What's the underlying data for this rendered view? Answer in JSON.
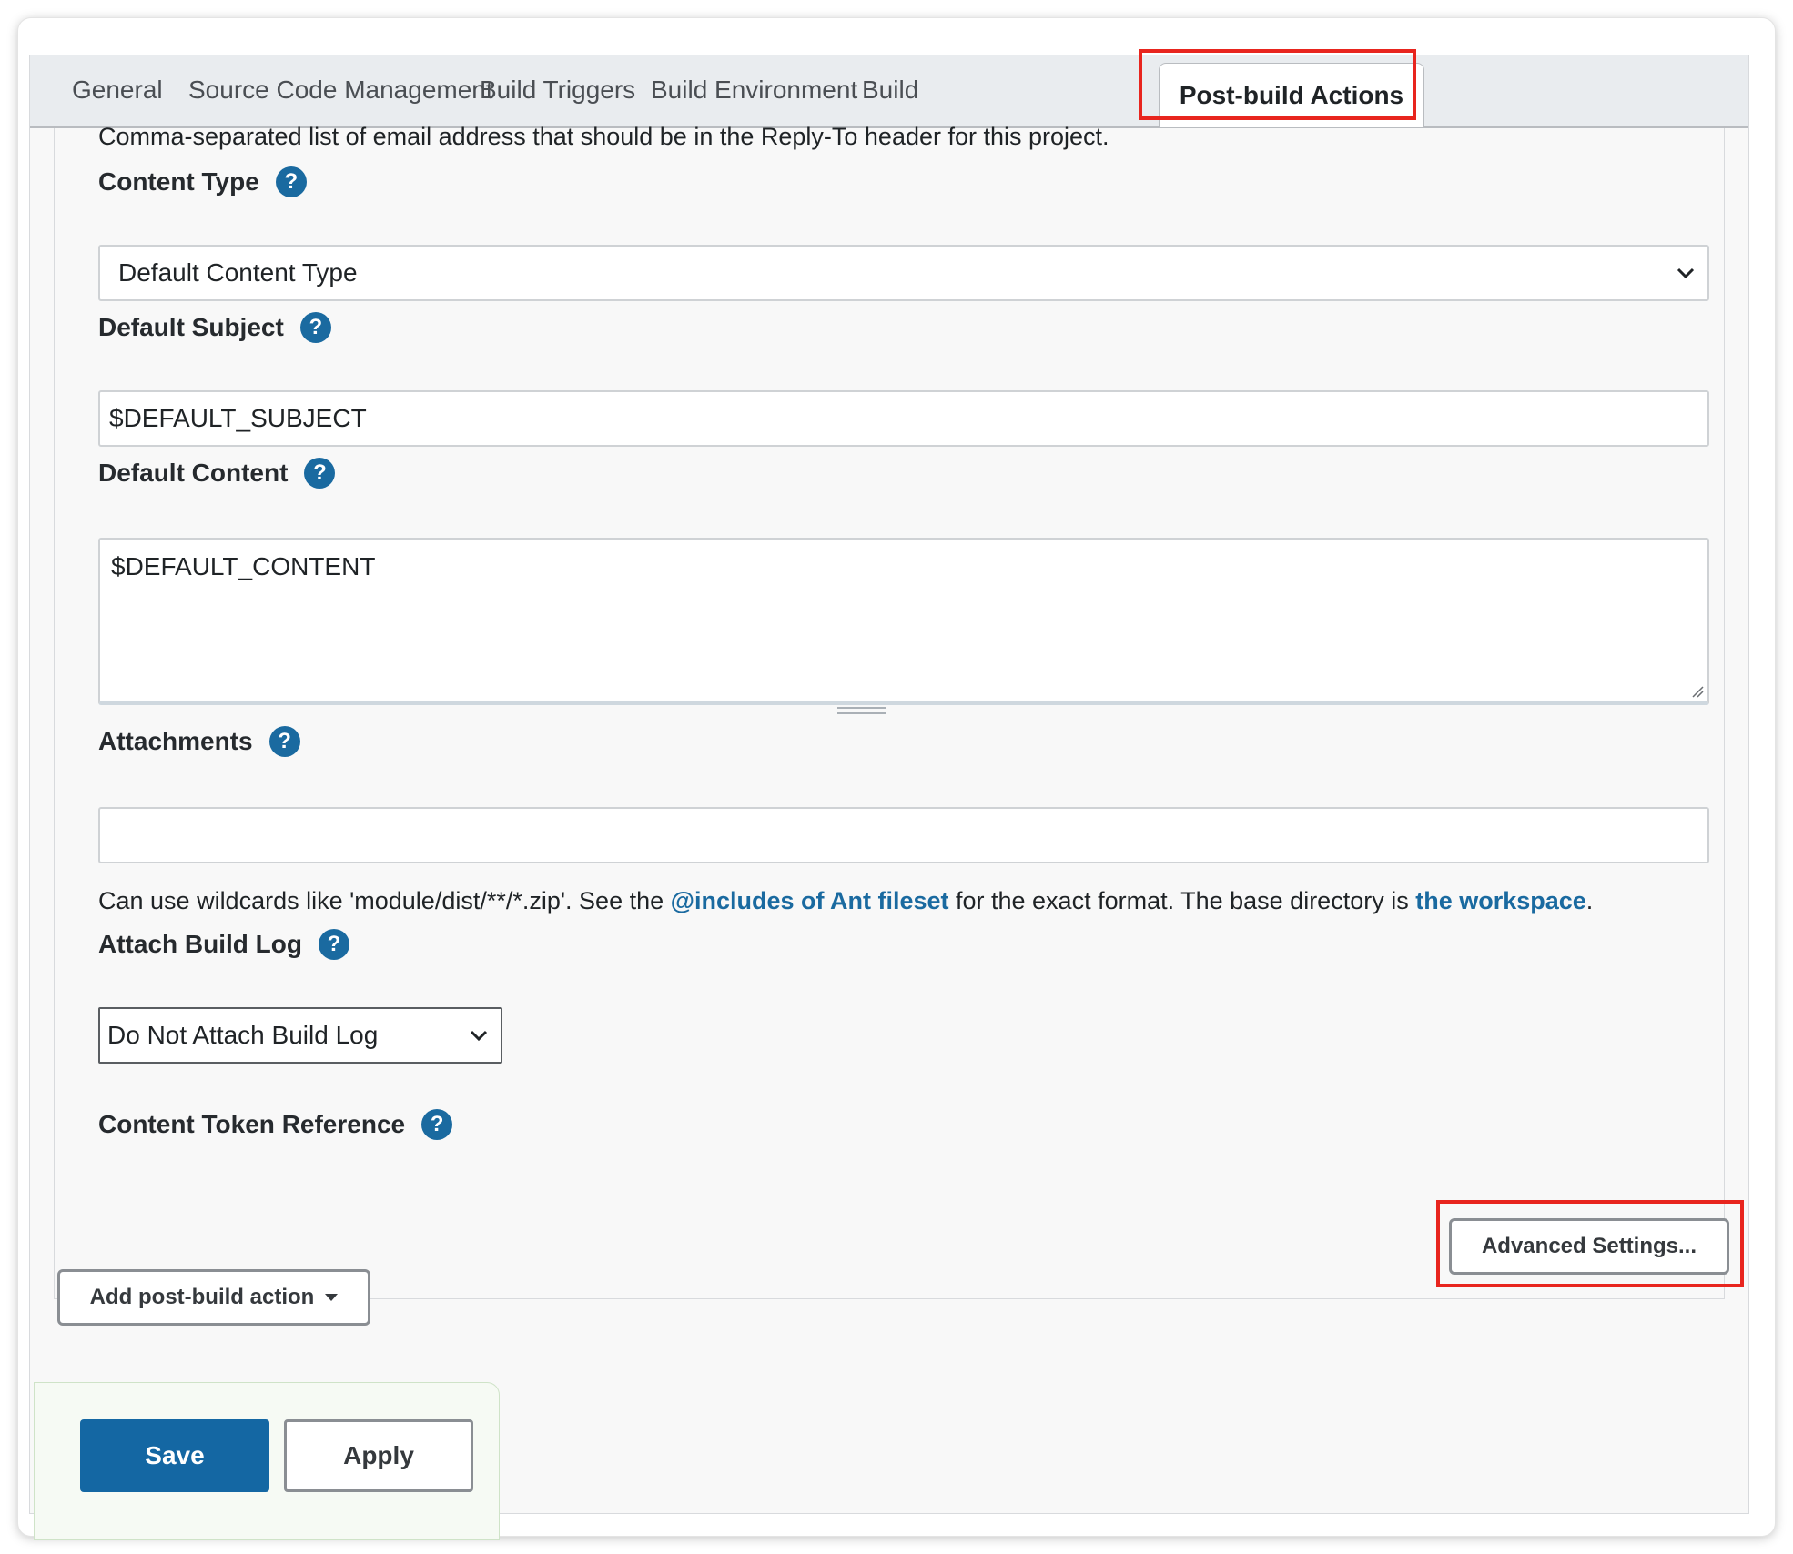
{
  "tabs": [
    {
      "label": "General"
    },
    {
      "label": "Source Code Management"
    },
    {
      "label": "Build Triggers"
    },
    {
      "label": "Build Environment"
    },
    {
      "label": "Build"
    },
    {
      "label": "Post-build Actions"
    }
  ],
  "active_tab": "Post-build Actions",
  "reply_to_description": "Comma-separated list of email address that should be in the Reply-To header for this project.",
  "content_type": {
    "label": "Content Type",
    "selected": "Default Content Type"
  },
  "default_subject": {
    "label": "Default Subject",
    "value": "$DEFAULT_SUBJECT"
  },
  "default_content": {
    "label": "Default Content",
    "value": "$DEFAULT_CONTENT"
  },
  "attachments": {
    "label": "Attachments",
    "value": "",
    "help_prefix": "Can use wildcards like 'module/dist/**/*.zip'. See the ",
    "help_link1": "@includes of Ant fileset",
    "help_middle": " for the exact format. The base directory is ",
    "help_link2": "the workspace",
    "help_suffix": "."
  },
  "attach_build_log": {
    "label": "Attach Build Log",
    "selected": "Do Not Attach Build Log"
  },
  "content_token_reference": {
    "label": "Content Token Reference"
  },
  "help_icon_glyph": "?",
  "buttons": {
    "advanced_settings": "Advanced Settings...",
    "add_post_build_action": "Add post-build action",
    "save": "Save",
    "apply": "Apply"
  },
  "colors": {
    "accent": "#1467a3",
    "highlight": "#e8251e",
    "link": "#1a6aa0"
  },
  "icons": {
    "help": "question-circle-icon",
    "dropdown": "chevron-down-icon",
    "caret": "caret-down-icon"
  }
}
